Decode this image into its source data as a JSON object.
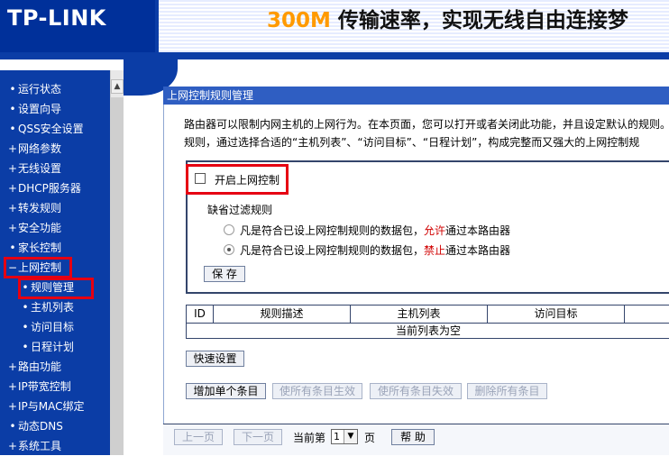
{
  "header": {
    "logo": "TP-LINK",
    "banner_highlight": "300M",
    "banner_rest": " 传输速率，实现无线自由连接梦"
  },
  "sidebar": {
    "items": [
      {
        "marker": "•",
        "label": "运行状态"
      },
      {
        "marker": "•",
        "label": "设置向导"
      },
      {
        "marker": "•",
        "label": "QSS安全设置"
      },
      {
        "marker": "+",
        "label": "网络参数"
      },
      {
        "marker": "+",
        "label": "无线设置"
      },
      {
        "marker": "+",
        "label": "DHCP服务器"
      },
      {
        "marker": "+",
        "label": "转发规则"
      },
      {
        "marker": "+",
        "label": "安全功能"
      },
      {
        "marker": "•",
        "label": "家长控制"
      },
      {
        "marker": "−",
        "label": "上网控制"
      },
      {
        "marker": "•",
        "label": "规则管理"
      },
      {
        "marker": "•",
        "label": "主机列表"
      },
      {
        "marker": "•",
        "label": "访问目标"
      },
      {
        "marker": "•",
        "label": "日程计划"
      },
      {
        "marker": "+",
        "label": "路由功能"
      },
      {
        "marker": "+",
        "label": "IP带宽控制"
      },
      {
        "marker": "+",
        "label": "IP与MAC绑定"
      },
      {
        "marker": "•",
        "label": "动态DNS"
      },
      {
        "marker": "+",
        "label": "系统工具"
      }
    ]
  },
  "panel": {
    "title": "上网控制规则管理",
    "desc_line1": "路由器可以限制内网主机的上网行为。在本页面，您可以打开或者关闭此功能，并且设定默认的规则。",
    "desc_line2": "规则，通过选择合适的“主机列表”、“访问目标”、“日程计划”，构成完整而又强大的上网控制规"
  },
  "control": {
    "enable_label": "开启上网控制",
    "default_filter_title": "缺省过滤规则",
    "option1_pre": "凡是符合已设上网控制规则的数据包，",
    "option1_hl": "允许",
    "option1_post": "通过本路由器",
    "option2_pre": "凡是符合已设上网控制规则的数据包，",
    "option2_hl": "禁止",
    "option2_post": "通过本路由器",
    "save_label": "保 存"
  },
  "table": {
    "columns": [
      "ID",
      "规则描述",
      "主机列表",
      "访问目标",
      ""
    ],
    "empty_text": "当前列表为空"
  },
  "buttons": {
    "quick_setup": "快速设置",
    "add_single": "增加单个条目",
    "enable_all": "使所有条目生效",
    "disable_all": "使所有条目失效",
    "delete_all": "删除所有条目"
  },
  "pager": {
    "prev": "上一页",
    "next": "下一页",
    "current_label": "当前第",
    "page_value": "1",
    "page_unit": "页",
    "help": "帮 助"
  }
}
